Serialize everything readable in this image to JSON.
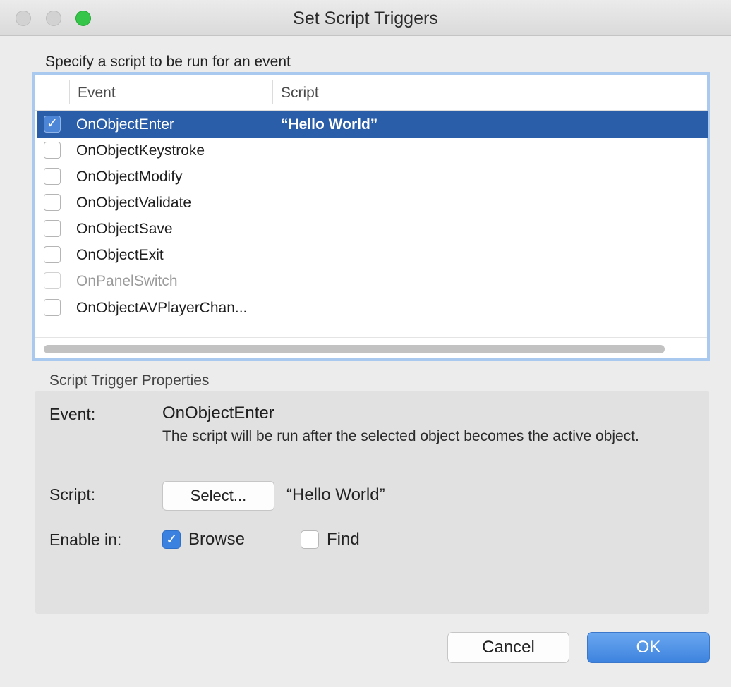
{
  "window": {
    "title": "Set Script Triggers"
  },
  "list_section": {
    "label": "Specify a script to be run for an event",
    "columns": {
      "event": "Event",
      "script": "Script"
    },
    "rows": [
      {
        "event": "OnObjectEnter",
        "script": "“Hello World”",
        "checked": true,
        "selected": true,
        "enabled": true
      },
      {
        "event": "OnObjectKeystroke",
        "script": "",
        "checked": false,
        "selected": false,
        "enabled": true
      },
      {
        "event": "OnObjectModify",
        "script": "",
        "checked": false,
        "selected": false,
        "enabled": true
      },
      {
        "event": "OnObjectValidate",
        "script": "",
        "checked": false,
        "selected": false,
        "enabled": true
      },
      {
        "event": "OnObjectSave",
        "script": "",
        "checked": false,
        "selected": false,
        "enabled": true
      },
      {
        "event": "OnObjectExit",
        "script": "",
        "checked": false,
        "selected": false,
        "enabled": true
      },
      {
        "event": "OnPanelSwitch",
        "script": "",
        "checked": false,
        "selected": false,
        "enabled": false
      },
      {
        "event": "OnObjectAVPlayerChan...",
        "script": "",
        "checked": false,
        "selected": false,
        "enabled": true
      }
    ]
  },
  "properties": {
    "section_label": "Script Trigger Properties",
    "event_label": "Event:",
    "event_value": "OnObjectEnter",
    "event_description": "The script will be run after the selected object becomes the active object.",
    "script_label": "Script:",
    "select_button": "Select...",
    "script_value": "“Hello World”",
    "enable_label": "Enable in:",
    "browse_label": "Browse",
    "browse_checked": true,
    "find_label": "Find",
    "find_checked": false
  },
  "buttons": {
    "cancel": "Cancel",
    "ok": "OK"
  },
  "colors": {
    "selection": "#2b5ea9",
    "accent": "#3b82e0",
    "focus_ring": "#a9c9ee"
  },
  "icons": {
    "check": "checkmark-icon"
  }
}
